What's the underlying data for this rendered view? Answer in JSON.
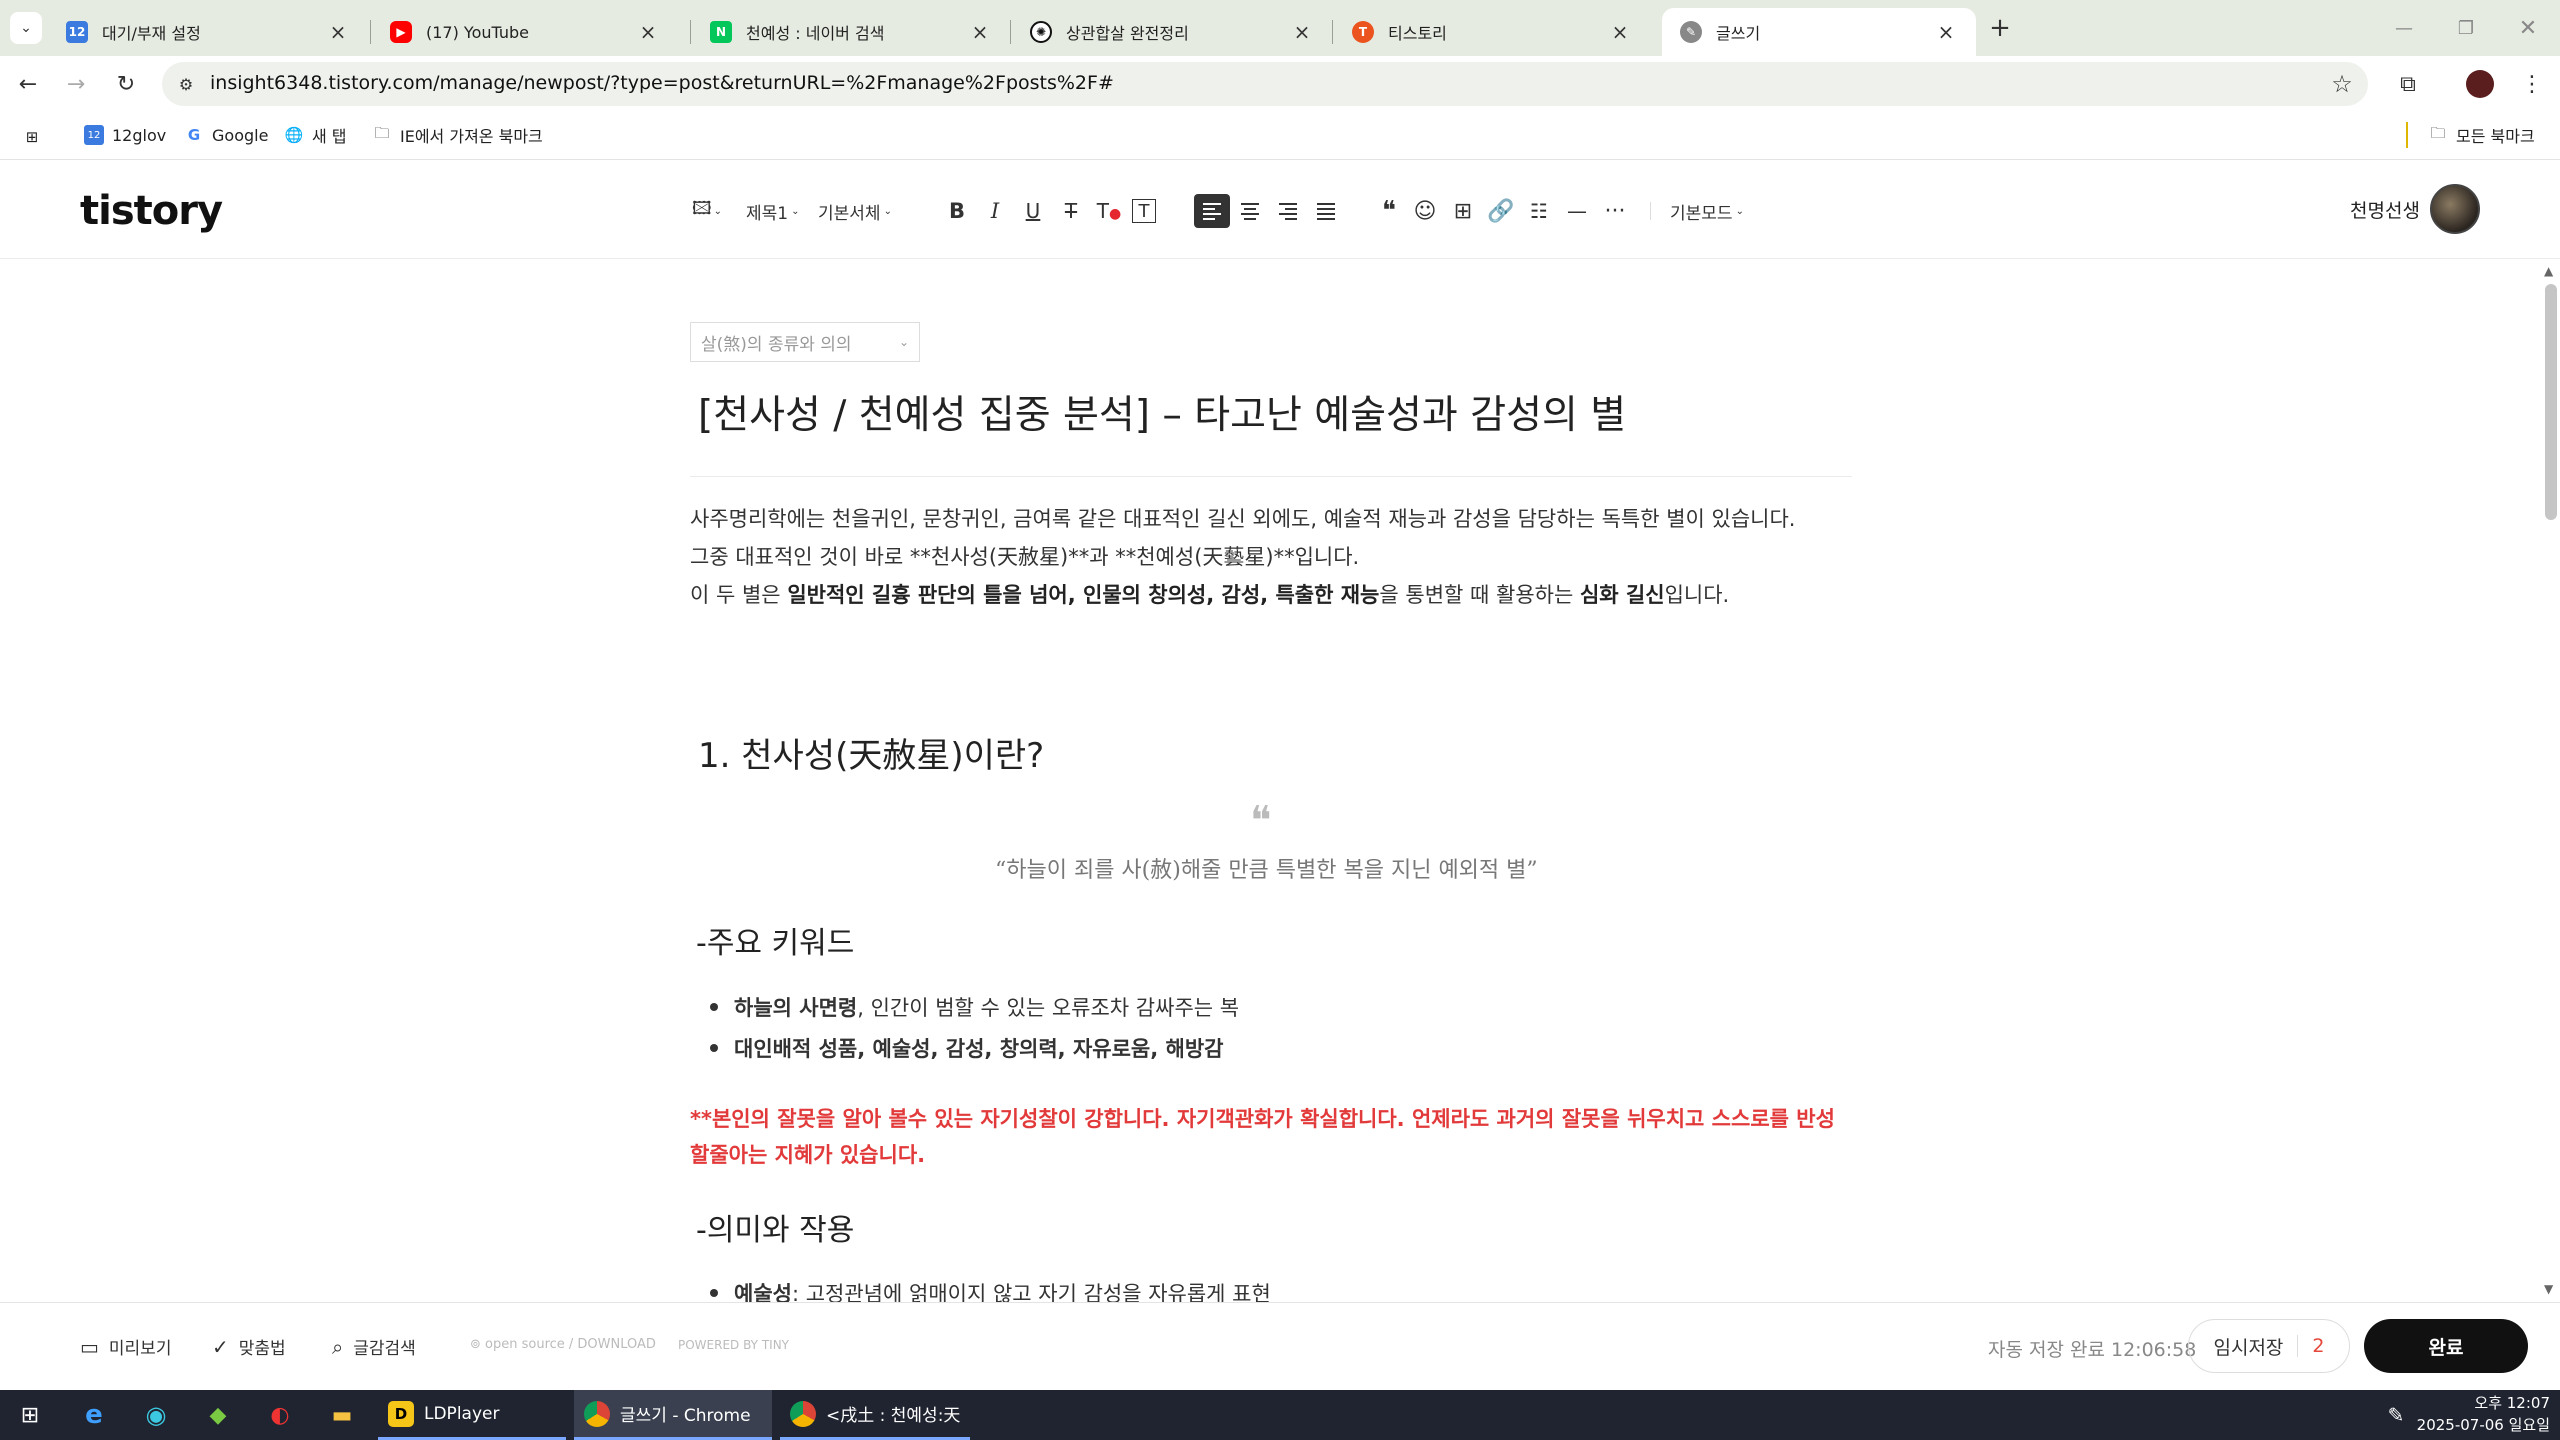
{
  "browser": {
    "tabs": [
      {
        "title": "대기/부재 설정",
        "favicon": "12glov",
        "color": "#3b7be0"
      },
      {
        "title": "(17) YouTube",
        "favicon": "youtube",
        "color": "#ff0000"
      },
      {
        "title": "천예성 : 네이버 검색",
        "favicon": "N",
        "color": "#03c75a"
      },
      {
        "title": "상관합살 완전정리",
        "favicon": "openai",
        "color": "#111111"
      },
      {
        "title": "티스토리",
        "favicon": "T",
        "color": "#eb531f"
      },
      {
        "title": "글쓰기",
        "favicon": "tistory",
        "color": "#777777"
      }
    ],
    "active_tab": 5,
    "url": "insight6348.tistory.com/manage/newpost/?type=post&returnURL=%2Fmanage%2Fposts%2F#",
    "bookmarks": [
      {
        "label": "12glov"
      },
      {
        "label": "Google"
      },
      {
        "label": "새 탭"
      },
      {
        "label": "IE에서 가져온 북마크"
      }
    ],
    "all_bookmarks": "모든 북마크"
  },
  "editor": {
    "logo": "tistory",
    "toolbar": {
      "heading": "제목1",
      "font": "기본서체",
      "mode": "기본모드"
    },
    "user": "천명선생"
  },
  "post": {
    "category": "살(煞)의 종류와 의의",
    "title": "[천사성 / 천예성 집중 분석] – 타고난 예술성과 감성의 별",
    "intro1": "사주명리학에는 천을귀인, 문창귀인, 금여록 같은 대표적인 길신 외에도, 예술적 재능과 감성을 담당하는 독특한 별이 있습니다.",
    "intro2": "그중 대표적인 것이 바로 **천사성(天赦星)**과 **천예성(天藝星)**입니다.",
    "intro3_a": "이 두 별은 ",
    "intro3_b": "일반적인 길흉 판단의 틀을 넘어, 인물의 창의성, 감성, 특출한 재능",
    "intro3_c": "을 통변할 때 활용하는 ",
    "intro3_d": "심화 길신",
    "intro3_e": "입니다.",
    "section1": "1. 천사성(天赦星)이란?",
    "quote": "“하늘이 죄를 사(赦)해줄 만큼 특별한 복을 지닌 예외적 별”",
    "kw_heading": "-주요 키워드",
    "kw1_bold": "하늘의 사면령",
    "kw1_rest": ", 인간이 범할 수 있는 오류조차 감싸주는 복",
    "kw2_bold": "대인배적 성품, 예술성, 감성, 창의력, 자유로움, 해방감",
    "red1": "**본인의 잘못을 알아 볼수 있는 자기성찰이 강합니다. 자기객관화가 확실합니다. 언제라도 과거의 잘못을 뉘우치고 스스로를 반성",
    "red2": "할줄아는 지혜가 있습니다.",
    "meaning_heading": "-의미와 작용",
    "m1_bold": "예술성",
    "m1_rest": ": 고정관념에 얽매이지 않고 자기 감성을 자유롭게 표현"
  },
  "footer": {
    "preview": "미리보기",
    "spell": "맞춤법",
    "search": "글감검색",
    "oss": "open source / DOWNLOAD",
    "tiny": "POWERED BY TINY",
    "autosave": "자동 저장 완료 12:06:58",
    "tempsave": "임시저장",
    "tempsave_count": "2",
    "done": "완료"
  },
  "taskbar": {
    "apps": [
      {
        "label": "LDPlayer"
      },
      {
        "label": "글쓰기 - Chrome"
      },
      {
        "label": "<戌土 : 천예성:天..."
      }
    ],
    "time": "오후 12:07",
    "date": "2025-07-06 일요일"
  }
}
